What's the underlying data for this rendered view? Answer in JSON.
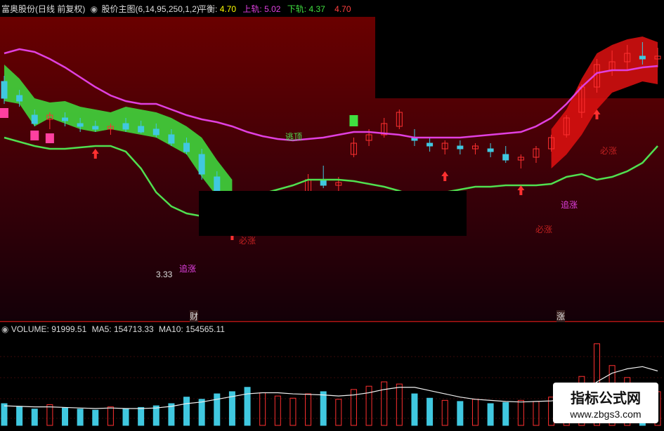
{
  "header": {
    "stock_title": "富奥股份(日线 前复权)",
    "indicator_name": "股价主图(6,14,95,250,1,2)",
    "mid_label": "平衡:",
    "mid_value": "4.70",
    "upper_label": "上轨:",
    "upper_value": "5.02",
    "lower_label": "下轨:",
    "lower_value": "4.37",
    "extra_value": "4.70"
  },
  "volume_header": {
    "label": "VOLUME:",
    "value": "91999.51",
    "ma5_label": "MA5:",
    "ma5_value": "154713.33",
    "ma10_label": "MA10:",
    "ma10_value": "154565.11"
  },
  "annotations": {
    "escape_top": "逃顶",
    "chase": "追涨",
    "must_rise": "必涨",
    "price_low": "3.33",
    "cai": "财",
    "zhang": "涨"
  },
  "watermark": {
    "title": "指标公式网",
    "url": "www.zbgs3.com"
  },
  "colors": {
    "upper_band": "#e040e0",
    "lower_band": "#50e050",
    "up_candle": "#ff3030",
    "down_candle": "#40c8e0",
    "mid_value": "#ffff00",
    "upper_value": "#e040e0",
    "lower_value": "#40e040",
    "extra_value": "#ff4040"
  },
  "chart_data": {
    "type": "line",
    "series": [
      {
        "values": [
          5.02,
          5.05,
          5.03,
          4.98,
          4.92,
          4.85,
          4.78,
          4.72,
          4.68,
          4.66,
          4.66,
          4.62,
          4.58,
          4.55,
          4.53,
          4.5,
          4.46,
          4.43,
          4.41,
          4.4,
          4.41,
          4.42,
          4.44,
          4.46,
          4.46,
          4.45,
          4.44,
          4.42,
          4.42,
          4.42,
          4.42,
          4.43,
          4.44,
          4.45,
          4.46,
          4.5,
          4.56,
          4.66,
          4.78,
          4.88,
          4.9,
          4.9,
          4.92,
          4.93
        ]
      },
      {
        "values": [
          4.42,
          4.39,
          4.36,
          4.34,
          4.34,
          4.35,
          4.36,
          4.36,
          4.32,
          4.2,
          4.03,
          3.93,
          3.88,
          3.86,
          3.9,
          3.95,
          3.98,
          4.02,
          4.05,
          4.08,
          4.12,
          4.12,
          4.12,
          4.11,
          4.09,
          4.07,
          4.04,
          4.0,
          3.99,
          4.03,
          4.05,
          4.07,
          4.07,
          4.08,
          4.08,
          4.08,
          4.09,
          4.14,
          4.16,
          4.12,
          4.14,
          4.18,
          4.24,
          4.36
        ]
      }
    ],
    "candles": [
      [
        4.82,
        4.86,
        4.66,
        4.7
      ],
      [
        4.72,
        4.76,
        4.64,
        4.68
      ],
      [
        4.58,
        4.62,
        4.5,
        4.52
      ],
      [
        4.55,
        4.6,
        4.48,
        4.58
      ],
      [
        4.56,
        4.6,
        4.5,
        4.54
      ],
      [
        4.52,
        4.56,
        4.46,
        4.5
      ],
      [
        4.5,
        4.54,
        4.46,
        4.48
      ],
      [
        4.48,
        4.52,
        4.44,
        4.5
      ],
      [
        4.52,
        4.56,
        4.46,
        4.48
      ],
      [
        4.5,
        4.54,
        4.45,
        4.46
      ],
      [
        4.48,
        4.52,
        4.42,
        4.44
      ],
      [
        4.44,
        4.48,
        4.36,
        4.38
      ],
      [
        4.38,
        4.42,
        4.3,
        4.32
      ],
      [
        4.3,
        4.34,
        4.12,
        4.16
      ],
      [
        4.14,
        4.18,
        4.0,
        4.02
      ],
      [
        4.0,
        4.04,
        3.88,
        3.92
      ],
      [
        3.94,
        3.98,
        3.8,
        3.84
      ],
      [
        3.84,
        3.9,
        3.78,
        3.86
      ],
      [
        3.86,
        3.94,
        3.82,
        3.92
      ],
      [
        3.92,
        4.02,
        3.9,
        4.0
      ],
      [
        4.0,
        4.16,
        3.98,
        4.12
      ],
      [
        4.12,
        4.22,
        4.06,
        4.08
      ],
      [
        4.08,
        4.14,
        4.02,
        4.1
      ],
      [
        4.3,
        4.42,
        4.28,
        4.38
      ],
      [
        4.4,
        4.48,
        4.36,
        4.44
      ],
      [
        4.44,
        4.56,
        4.42,
        4.52
      ],
      [
        4.5,
        4.62,
        4.48,
        4.6
      ],
      [
        4.42,
        4.48,
        4.36,
        4.4
      ],
      [
        4.38,
        4.42,
        4.32,
        4.36
      ],
      [
        4.34,
        4.4,
        4.3,
        4.38
      ],
      [
        4.36,
        4.4,
        4.3,
        4.34
      ],
      [
        4.34,
        4.38,
        4.3,
        4.36
      ],
      [
        4.34,
        4.38,
        4.28,
        4.32
      ],
      [
        4.3,
        4.36,
        4.24,
        4.26
      ],
      [
        4.26,
        4.3,
        4.2,
        4.28
      ],
      [
        4.28,
        4.36,
        4.24,
        4.34
      ],
      [
        4.34,
        4.44,
        4.32,
        4.42
      ],
      [
        4.44,
        4.58,
        4.42,
        4.56
      ],
      [
        4.6,
        4.8,
        4.56,
        4.78
      ],
      [
        4.78,
        4.98,
        4.74,
        4.94
      ],
      [
        4.9,
        5.04,
        4.86,
        4.96
      ],
      [
        4.96,
        5.08,
        4.9,
        5.02
      ],
      [
        5.0,
        5.1,
        4.94,
        4.98
      ],
      [
        4.98,
        5.06,
        4.92,
        5.0
      ]
    ],
    "volume": [
      40,
      35,
      30,
      38,
      32,
      30,
      28,
      34,
      30,
      33,
      36,
      40,
      52,
      48,
      58,
      62,
      70,
      60,
      54,
      50,
      58,
      62,
      48,
      66,
      72,
      80,
      76,
      58,
      50,
      46,
      44,
      48,
      40,
      42,
      46,
      44,
      52,
      60,
      90,
      150,
      110,
      88,
      70,
      62
    ],
    "volume_ma5": [
      36,
      35,
      34,
      34,
      33,
      32,
      31,
      32,
      31,
      31,
      32,
      35,
      40,
      43,
      48,
      53,
      58,
      60,
      60,
      58,
      57,
      56,
      54,
      56,
      60,
      66,
      70,
      70,
      64,
      58,
      52,
      48,
      46,
      44,
      43,
      44,
      45,
      48,
      58,
      80,
      96,
      104,
      108,
      100
    ]
  }
}
